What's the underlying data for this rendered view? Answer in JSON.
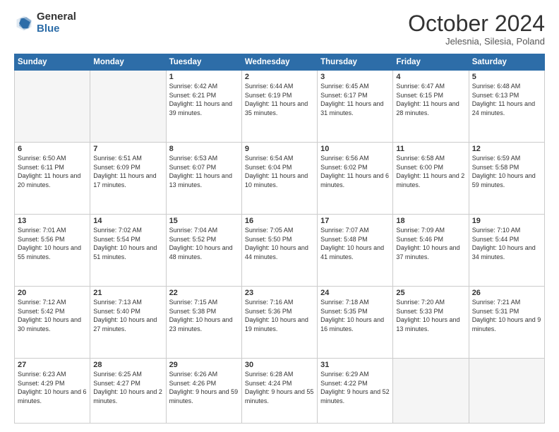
{
  "logo": {
    "general": "General",
    "blue": "Blue"
  },
  "header": {
    "title": "October 2024",
    "subtitle": "Jelesnia, Silesia, Poland"
  },
  "weekdays": [
    "Sunday",
    "Monday",
    "Tuesday",
    "Wednesday",
    "Thursday",
    "Friday",
    "Saturday"
  ],
  "weeks": [
    [
      {
        "day": "",
        "info": ""
      },
      {
        "day": "",
        "info": ""
      },
      {
        "day": "1",
        "info": "Sunrise: 6:42 AM\nSunset: 6:21 PM\nDaylight: 11 hours and 39 minutes."
      },
      {
        "day": "2",
        "info": "Sunrise: 6:44 AM\nSunset: 6:19 PM\nDaylight: 11 hours and 35 minutes."
      },
      {
        "day": "3",
        "info": "Sunrise: 6:45 AM\nSunset: 6:17 PM\nDaylight: 11 hours and 31 minutes."
      },
      {
        "day": "4",
        "info": "Sunrise: 6:47 AM\nSunset: 6:15 PM\nDaylight: 11 hours and 28 minutes."
      },
      {
        "day": "5",
        "info": "Sunrise: 6:48 AM\nSunset: 6:13 PM\nDaylight: 11 hours and 24 minutes."
      }
    ],
    [
      {
        "day": "6",
        "info": "Sunrise: 6:50 AM\nSunset: 6:11 PM\nDaylight: 11 hours and 20 minutes."
      },
      {
        "day": "7",
        "info": "Sunrise: 6:51 AM\nSunset: 6:09 PM\nDaylight: 11 hours and 17 minutes."
      },
      {
        "day": "8",
        "info": "Sunrise: 6:53 AM\nSunset: 6:07 PM\nDaylight: 11 hours and 13 minutes."
      },
      {
        "day": "9",
        "info": "Sunrise: 6:54 AM\nSunset: 6:04 PM\nDaylight: 11 hours and 10 minutes."
      },
      {
        "day": "10",
        "info": "Sunrise: 6:56 AM\nSunset: 6:02 PM\nDaylight: 11 hours and 6 minutes."
      },
      {
        "day": "11",
        "info": "Sunrise: 6:58 AM\nSunset: 6:00 PM\nDaylight: 11 hours and 2 minutes."
      },
      {
        "day": "12",
        "info": "Sunrise: 6:59 AM\nSunset: 5:58 PM\nDaylight: 10 hours and 59 minutes."
      }
    ],
    [
      {
        "day": "13",
        "info": "Sunrise: 7:01 AM\nSunset: 5:56 PM\nDaylight: 10 hours and 55 minutes."
      },
      {
        "day": "14",
        "info": "Sunrise: 7:02 AM\nSunset: 5:54 PM\nDaylight: 10 hours and 51 minutes."
      },
      {
        "day": "15",
        "info": "Sunrise: 7:04 AM\nSunset: 5:52 PM\nDaylight: 10 hours and 48 minutes."
      },
      {
        "day": "16",
        "info": "Sunrise: 7:05 AM\nSunset: 5:50 PM\nDaylight: 10 hours and 44 minutes."
      },
      {
        "day": "17",
        "info": "Sunrise: 7:07 AM\nSunset: 5:48 PM\nDaylight: 10 hours and 41 minutes."
      },
      {
        "day": "18",
        "info": "Sunrise: 7:09 AM\nSunset: 5:46 PM\nDaylight: 10 hours and 37 minutes."
      },
      {
        "day": "19",
        "info": "Sunrise: 7:10 AM\nSunset: 5:44 PM\nDaylight: 10 hours and 34 minutes."
      }
    ],
    [
      {
        "day": "20",
        "info": "Sunrise: 7:12 AM\nSunset: 5:42 PM\nDaylight: 10 hours and 30 minutes."
      },
      {
        "day": "21",
        "info": "Sunrise: 7:13 AM\nSunset: 5:40 PM\nDaylight: 10 hours and 27 minutes."
      },
      {
        "day": "22",
        "info": "Sunrise: 7:15 AM\nSunset: 5:38 PM\nDaylight: 10 hours and 23 minutes."
      },
      {
        "day": "23",
        "info": "Sunrise: 7:16 AM\nSunset: 5:36 PM\nDaylight: 10 hours and 19 minutes."
      },
      {
        "day": "24",
        "info": "Sunrise: 7:18 AM\nSunset: 5:35 PM\nDaylight: 10 hours and 16 minutes."
      },
      {
        "day": "25",
        "info": "Sunrise: 7:20 AM\nSunset: 5:33 PM\nDaylight: 10 hours and 13 minutes."
      },
      {
        "day": "26",
        "info": "Sunrise: 7:21 AM\nSunset: 5:31 PM\nDaylight: 10 hours and 9 minutes."
      }
    ],
    [
      {
        "day": "27",
        "info": "Sunrise: 6:23 AM\nSunset: 4:29 PM\nDaylight: 10 hours and 6 minutes."
      },
      {
        "day": "28",
        "info": "Sunrise: 6:25 AM\nSunset: 4:27 PM\nDaylight: 10 hours and 2 minutes."
      },
      {
        "day": "29",
        "info": "Sunrise: 6:26 AM\nSunset: 4:26 PM\nDaylight: 9 hours and 59 minutes."
      },
      {
        "day": "30",
        "info": "Sunrise: 6:28 AM\nSunset: 4:24 PM\nDaylight: 9 hours and 55 minutes."
      },
      {
        "day": "31",
        "info": "Sunrise: 6:29 AM\nSunset: 4:22 PM\nDaylight: 9 hours and 52 minutes."
      },
      {
        "day": "",
        "info": ""
      },
      {
        "day": "",
        "info": ""
      }
    ]
  ]
}
